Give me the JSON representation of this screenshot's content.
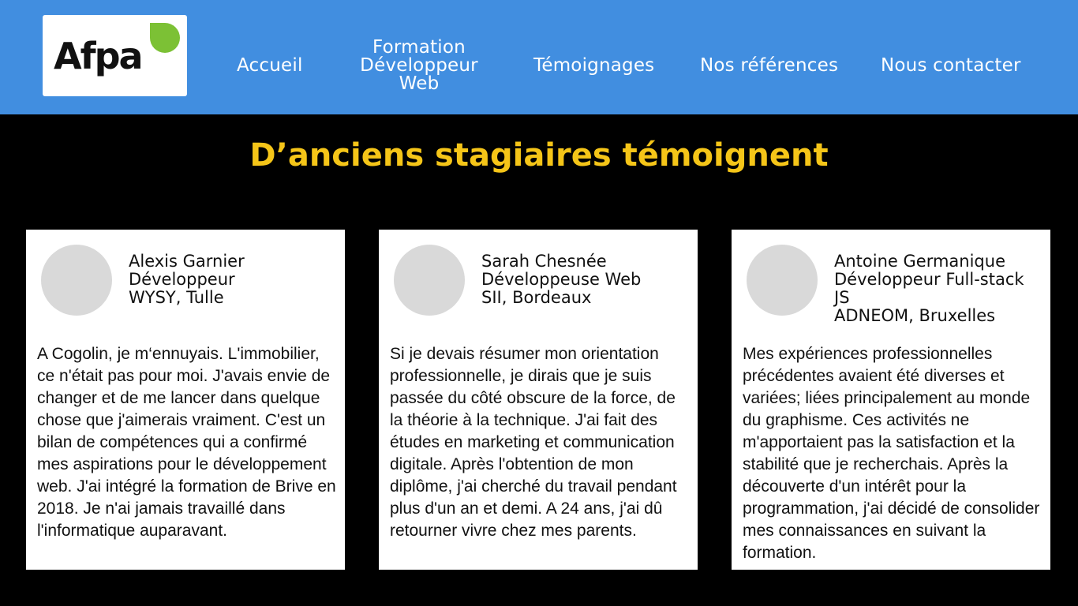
{
  "header": {
    "logo": "Afpa",
    "nav": {
      "accueil": "Accueil",
      "formation_line1": "Formation",
      "formation_line2": "Développeur",
      "formation_line3": "Web",
      "temoignages": "Témoignages",
      "references": "Nos références",
      "contact": "Nous contacter"
    },
    "colors": {
      "background": "#418ee0",
      "leaf": "#7cc135"
    }
  },
  "page_title": "D’anciens stagiaires témoignent",
  "title_color": "#f5c518",
  "testimonials": [
    {
      "name": "Alexis Garnier",
      "role": "Développeur",
      "company": "WYSY, Tulle",
      "quote": "A Cogolin, je m‘ennuyais. L'immobilier, ce n'était pas pour moi. J'avais envie de changer et de me lancer dans quelque chose que j'aimerais vraiment. C'est un bilan de compétences qui a confirmé mes aspirations pour le développement web. J'ai intégré la formation de Brive en 2018. Je n'ai jamais travaillé dans l'informatique auparavant."
    },
    {
      "name": "Sarah Chesnée",
      "role": "Développeuse Web",
      "company": "SII, Bordeaux",
      "quote": "Si je devais résumer mon orientation professionnelle, je dirais que je suis passée du côté obscure de la force, de la théorie à la technique. J'ai fait des études en marketing et communication digitale. Après l'obtention de mon diplôme, j'ai cherché du travail pendant plus d'un an et demi. A 24 ans, j'ai dû retourner vivre chez mes parents."
    },
    {
      "name": "Antoine Germanique",
      "role": "Développeur Full-stack JS",
      "company": "ADNEOM, Bruxelles",
      "quote": "Mes expériences professionnelles précédentes avaient été diverses et variées; liées principalement au monde du graphisme. Ces activités ne m'apportaient pas la satisfaction et la stabilité que je recherchais. Après la découverte d'un intérêt pour la programmation, j'ai décidé de consolider mes connaissances en suivant la formation."
    }
  ]
}
